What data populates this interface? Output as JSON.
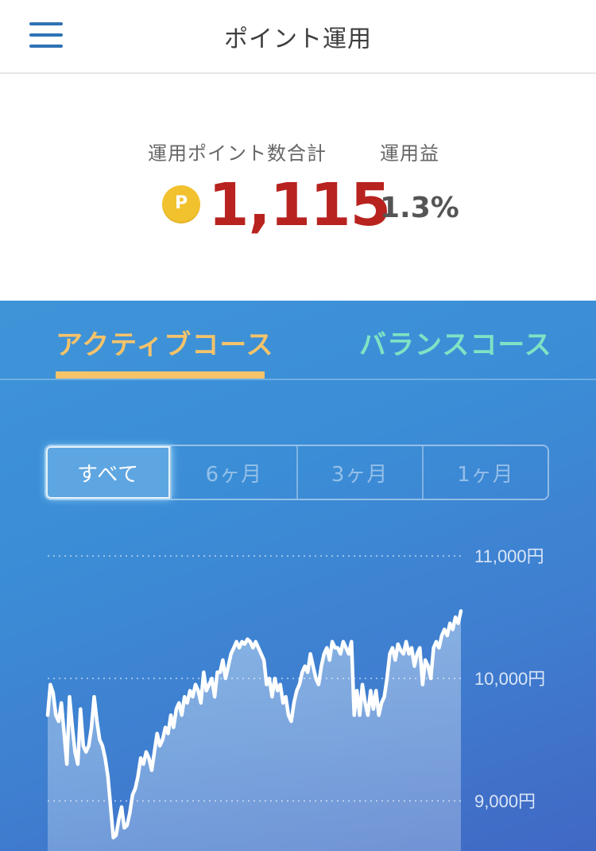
{
  "header": {
    "title": "ポイント運用",
    "menu_icon": "hamburger-menu-icon"
  },
  "summary": {
    "points_label": "運用ポイント数合計",
    "profit_label": "運用益",
    "coin_symbol": "P",
    "points_value": "1,115",
    "profit_value": "1.3%",
    "points_color": "#b8231f",
    "coin_color": "#f2c12e"
  },
  "tabs": [
    {
      "label": "アクティブコース",
      "active": true,
      "color": "#f5c36a"
    },
    {
      "label": "バランスコース",
      "active": false,
      "color": "#7ee3c4"
    }
  ],
  "periods": [
    {
      "label": "すべて",
      "active": true
    },
    {
      "label": "6ヶ月",
      "active": false
    },
    {
      "label": "3ヶ月",
      "active": false
    },
    {
      "label": "1ヶ月",
      "active": false
    }
  ],
  "chart_data": {
    "type": "area",
    "y_ticks": [
      "11,000円",
      "10,000円",
      "9,000円"
    ],
    "ylim": [
      8600,
      11000
    ],
    "grid": true,
    "values": [
      9700,
      9950,
      9880,
      9700,
      9650,
      9800,
      9550,
      9300,
      9850,
      9600,
      9400,
      9300,
      9750,
      9450,
      9400,
      9450,
      9600,
      9850,
      9650,
      9500,
      9450,
      9350,
      9200,
      8950,
      8700,
      8720,
      8850,
      8950,
      8780,
      8800,
      8900,
      9050,
      9100,
      9200,
      9350,
      9300,
      9400,
      9350,
      9250,
      9400,
      9550,
      9450,
      9500,
      9600,
      9550,
      9700,
      9600,
      9750,
      9800,
      9700,
      9850,
      9800,
      9900,
      9850,
      9950,
      9900,
      9800,
      10050,
      9900,
      9950,
      10000,
      9850,
      10050,
      10050,
      10150,
      10000,
      10100,
      10200,
      10250,
      10300,
      10250,
      10300,
      10280,
      10320,
      10300,
      10250,
      10300,
      10250,
      10200,
      10150,
      9950,
      10000,
      9850,
      10000,
      9900,
      9950,
      9800,
      9850,
      9700,
      9650,
      9800,
      9900,
      9950,
      10050,
      10100,
      10050,
      10200,
      10100,
      10000,
      9950,
      10100,
      10200,
      10250,
      10150,
      10300,
      10250,
      10250,
      10200,
      10300,
      10250,
      10200,
      10300,
      9700,
      9900,
      9700,
      9950,
      9800,
      9700,
      9900,
      9750,
      9900,
      9700,
      9800,
      9850,
      10000,
      10200,
      10250,
      10150,
      10280,
      10230,
      10200,
      10300,
      10200,
      10250,
      10100,
      10200,
      10250,
      9950,
      10150,
      10100,
      10000,
      10250,
      10300,
      10250,
      10350,
      10400,
      10350,
      10450,
      10400,
      10500,
      10450,
      10550
    ]
  }
}
